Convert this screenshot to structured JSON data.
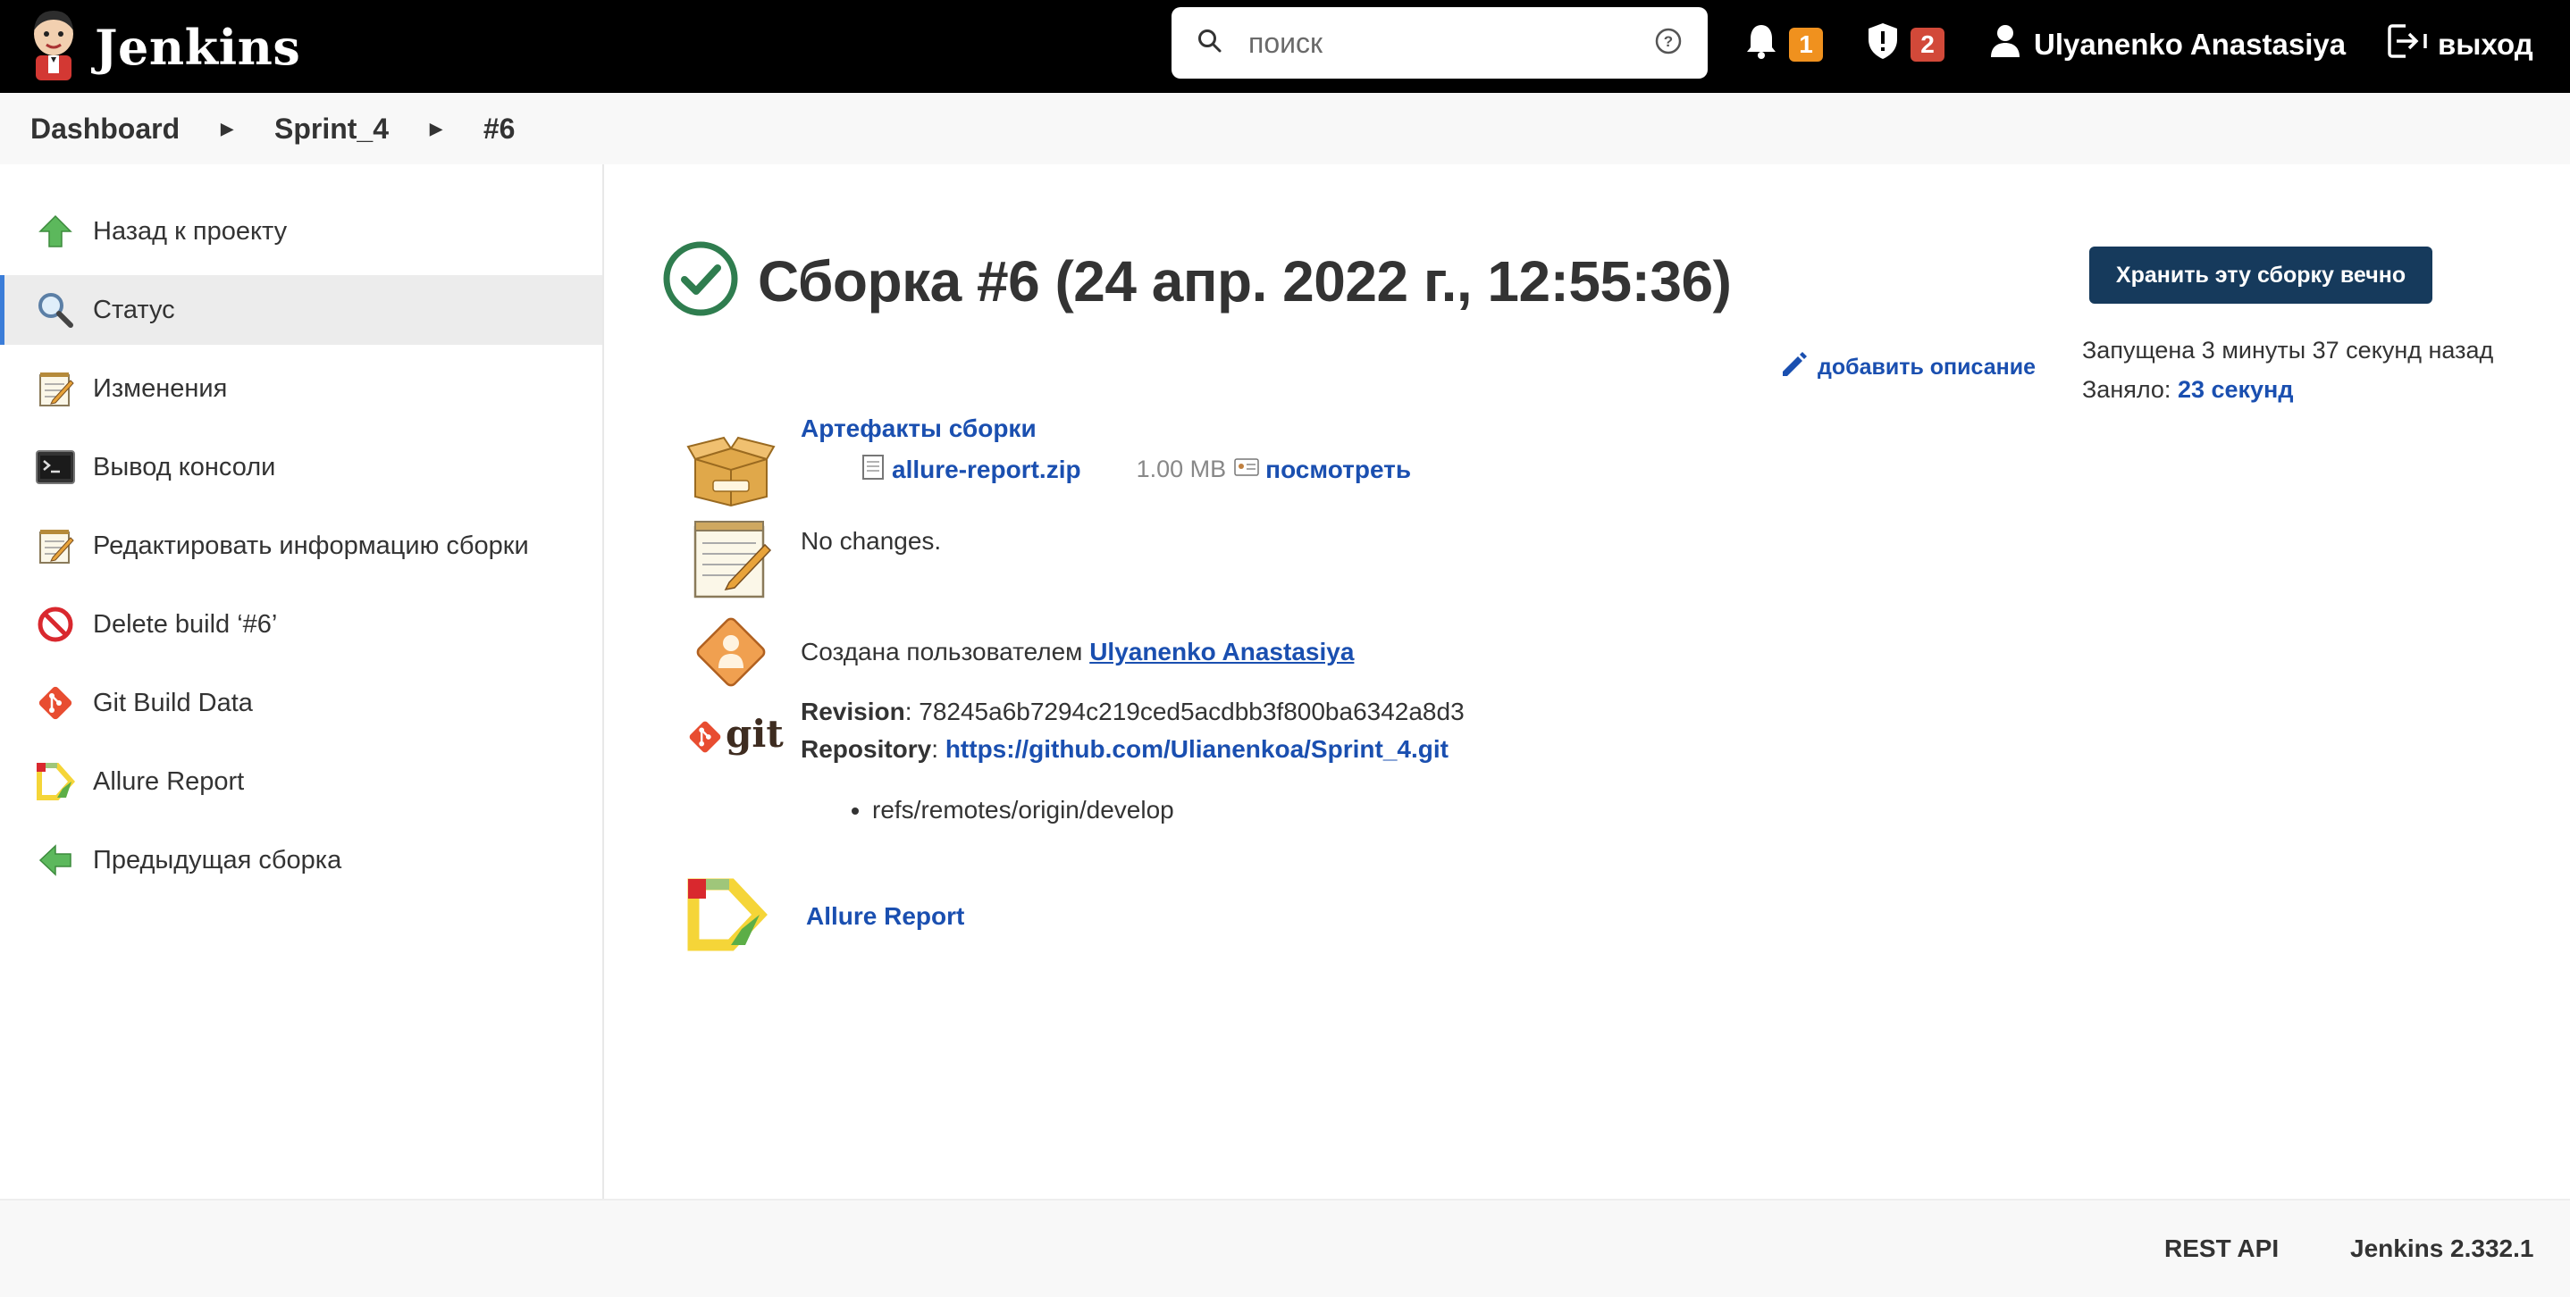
{
  "header": {
    "brand": "Jenkins",
    "search_placeholder": "поиск",
    "notifications_count": "1",
    "security_count": "2",
    "user_name": "Ulyanenko Anastasiya",
    "logout_label": "выход"
  },
  "breadcrumb": {
    "items": [
      "Dashboard",
      "Sprint_4",
      "#6"
    ]
  },
  "sidebar": {
    "items": [
      {
        "label": "Назад к проекту",
        "icon": "up-arrow-icon"
      },
      {
        "label": "Статус",
        "icon": "magnifier-icon"
      },
      {
        "label": "Изменения",
        "icon": "notepad-icon"
      },
      {
        "label": "Вывод консоли",
        "icon": "terminal-icon"
      },
      {
        "label": "Редактировать информацию сборки",
        "icon": "notepad-icon"
      },
      {
        "label": "Delete build ‘#6’",
        "icon": "no-entry-icon"
      },
      {
        "label": "Git Build Data",
        "icon": "git-icon"
      },
      {
        "label": "Allure Report",
        "icon": "allure-icon"
      },
      {
        "label": "Предыдущая сборка",
        "icon": "left-arrow-icon"
      }
    ]
  },
  "main": {
    "title": "Сборка #6 (24 апр. 2022 г., 12:55:36)",
    "keep_button": "Хранить эту сборку вечно",
    "add_description": "добавить описание",
    "started": "Запущена 3 минуты 37 секунд назад",
    "took_label": "Заняло:",
    "took_value": "23 секунд",
    "artifacts": {
      "heading": "Артефакты сборки",
      "file_name": "allure-report.zip",
      "file_size": "1.00 MB",
      "view_label": "посмотреть"
    },
    "changes_text": "No changes.",
    "created_by_label": "Создана пользователем",
    "created_by_user": "Ulyanenko Anastasiya",
    "git": {
      "logo_text": "git",
      "revision_label": "Revision",
      "revision_value": "78245a6b7294c219ced5acdbb3f800ba6342a8d3",
      "repository_label": "Repository",
      "repository_url": "https://github.com/Ulianenkoa/Sprint_4.git",
      "ref": "refs/remotes/origin/develop"
    },
    "allure_link": "Allure Report"
  },
  "footer": {
    "rest_api": "REST API",
    "version": "Jenkins 2.332.1"
  },
  "colors": {
    "link": "#1a4fb0",
    "keep_button": "#163a5c",
    "success_green": "#2f7d4f",
    "badge_orange": "#f0911e",
    "badge_red": "#d24939"
  }
}
